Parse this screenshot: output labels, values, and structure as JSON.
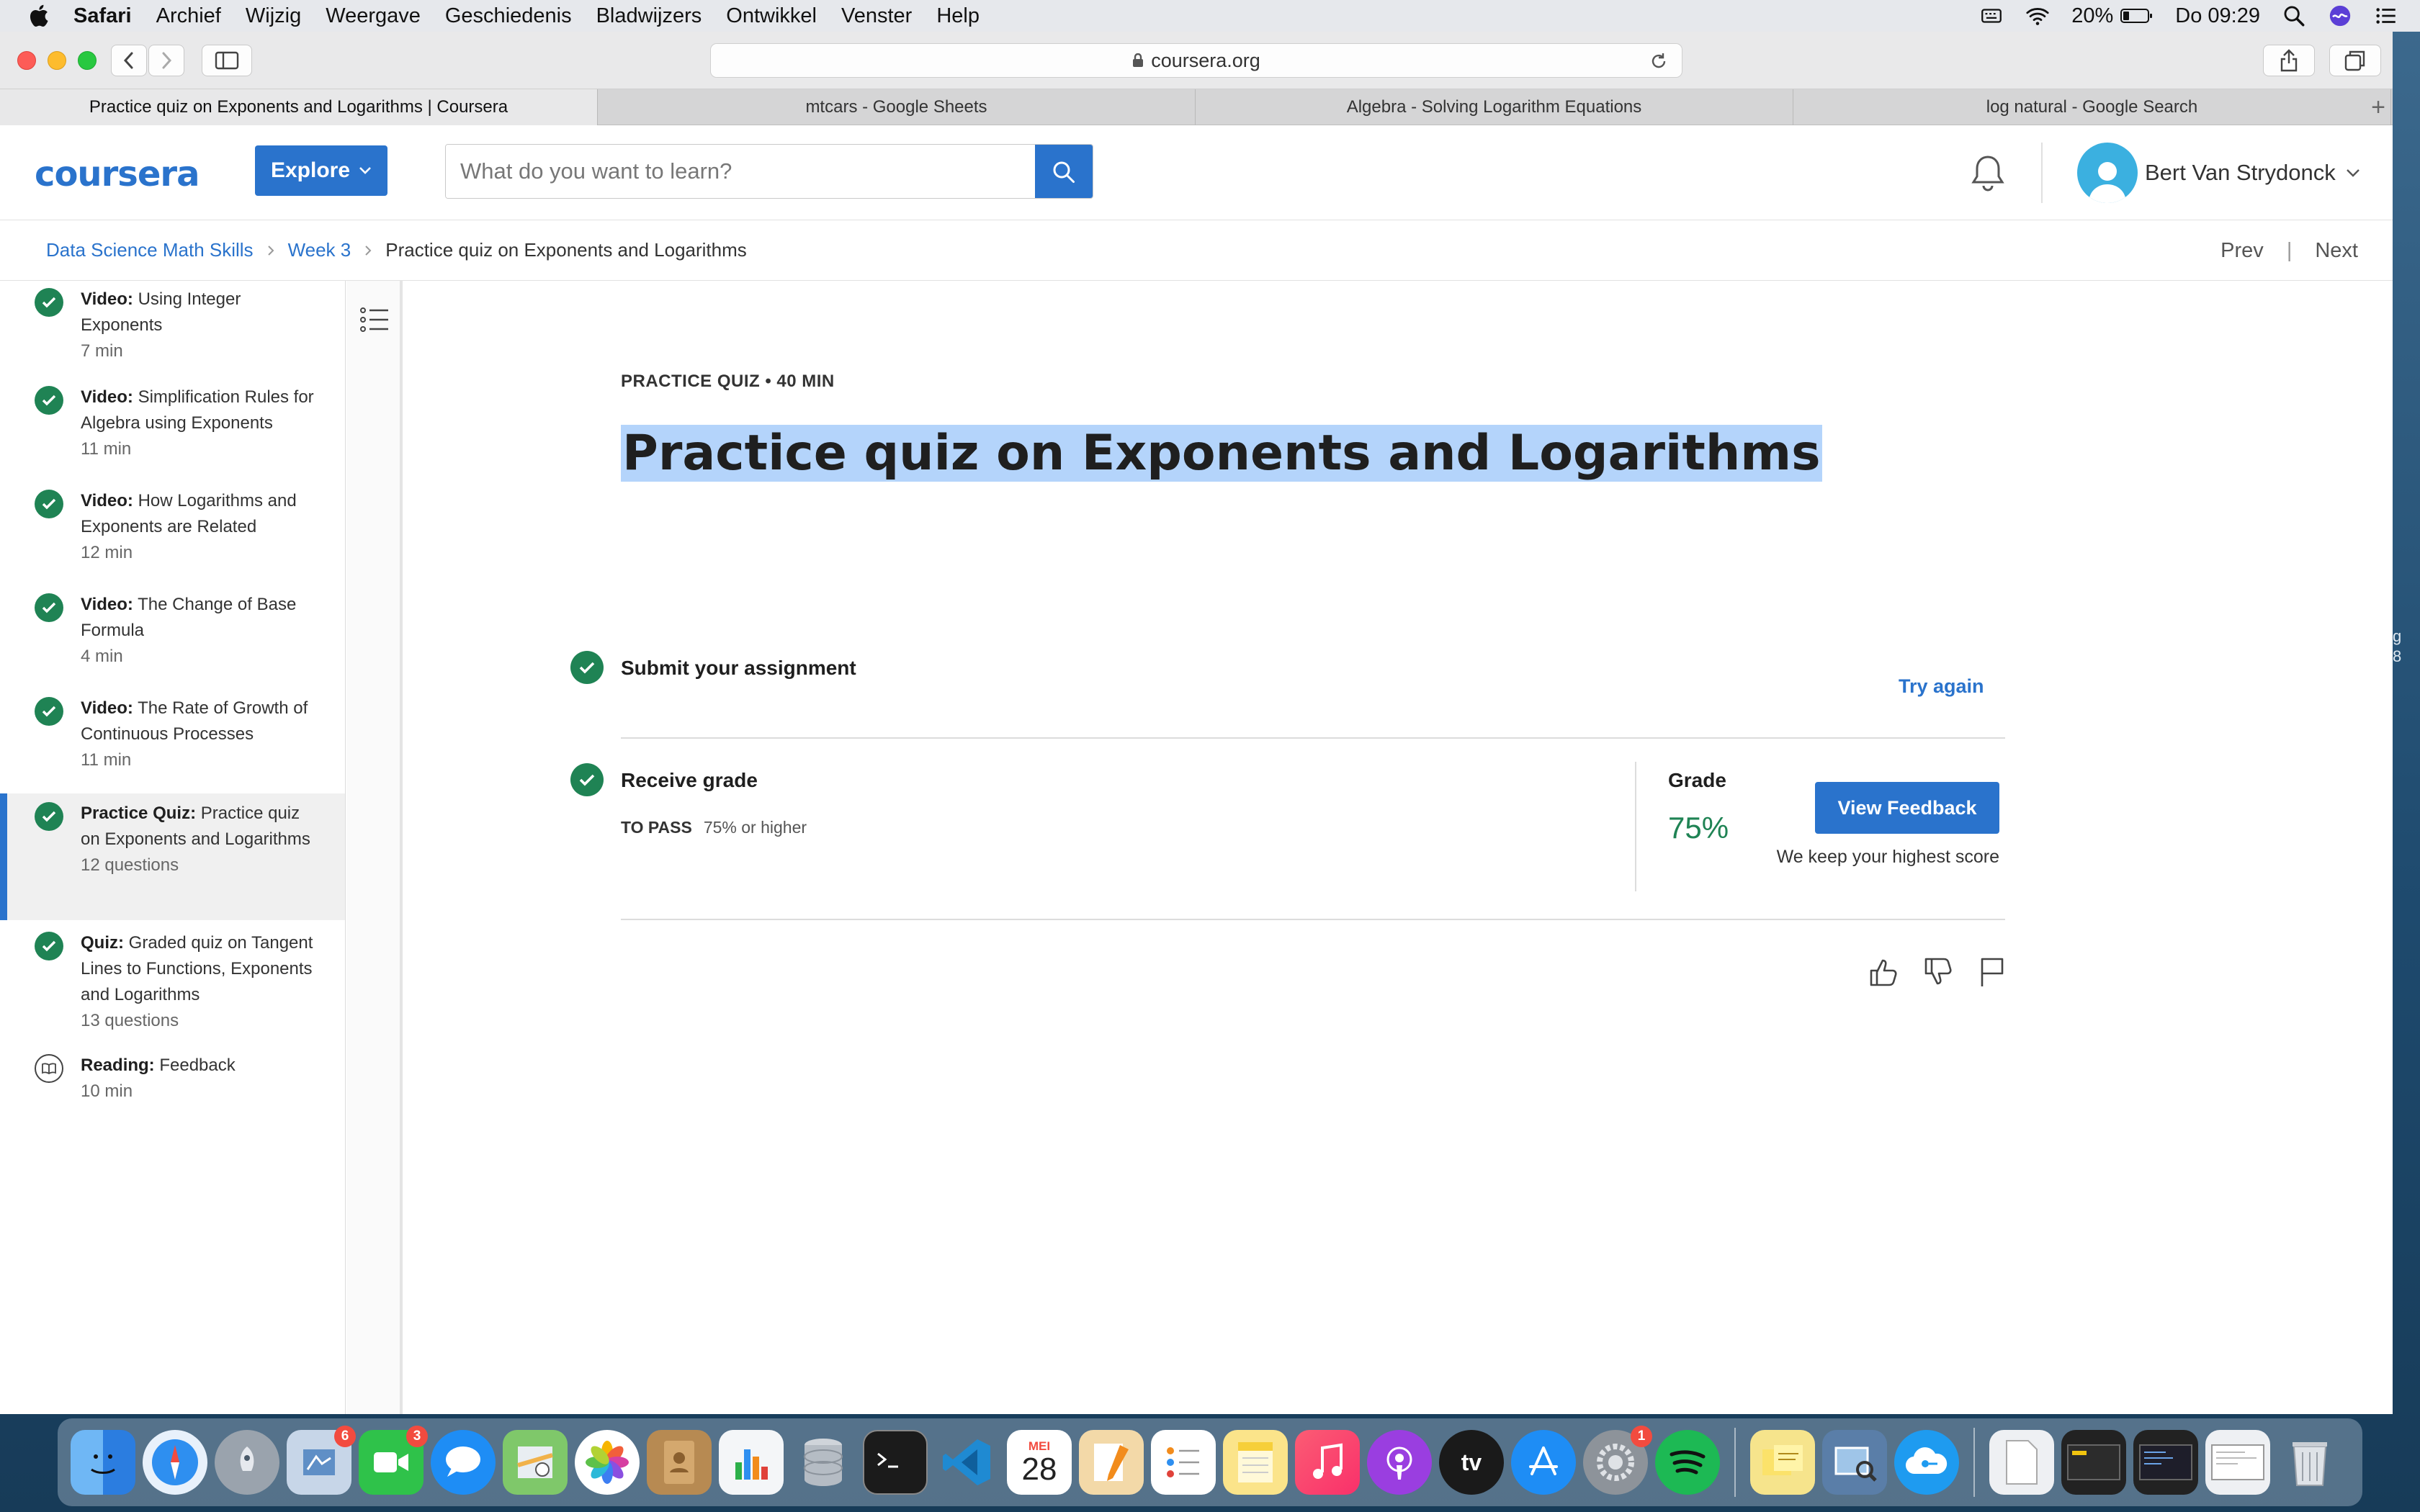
{
  "menubar": {
    "app": "Safari",
    "items": [
      "Archief",
      "Wijzig",
      "Weergave",
      "Geschiedenis",
      "Bladwijzers",
      "Ontwikkel",
      "Venster",
      "Help"
    ],
    "battery": "20%",
    "clock": "Do 09:29"
  },
  "browser": {
    "url": "coursera.org",
    "tabs": [
      "Practice quiz on Exponents and Logarithms | Coursera",
      "mtcars - Google Sheets",
      "Algebra - Solving Logarithm Equations",
      "log natural - Google Search"
    ],
    "tab_add": "+"
  },
  "header": {
    "logo": "coursera",
    "explore": "Explore",
    "search_placeholder": "What do you want to learn?",
    "user_name": "Bert Van Strydonck"
  },
  "breadcrumb": {
    "course": "Data Science Math Skills",
    "week": "Week 3",
    "current": "Practice quiz on Exponents and Logarithms",
    "prev": "Prev",
    "next": "Next",
    "divider": "|"
  },
  "sidebar": {
    "items": [
      {
        "type": "Video:",
        "title": "Using Integer Exponents",
        "meta": "7 min",
        "done": true
      },
      {
        "type": "Video:",
        "title": "Simplification Rules for Algebra using Exponents",
        "meta": "11 min",
        "done": true
      },
      {
        "type": "Video:",
        "title": "How Logarithms and Exponents are Related",
        "meta": "12 min",
        "done": true
      },
      {
        "type": "Video:",
        "title": "The Change of Base Formula",
        "meta": "4 min",
        "done": true
      },
      {
        "type": "Video:",
        "title": "The Rate of Growth of Continuous Processes",
        "meta": "11 min",
        "done": true
      },
      {
        "type": "Practice Quiz:",
        "title": "Practice quiz on Exponents and Logarithms",
        "meta": "12 questions",
        "done": true
      },
      {
        "type": "Quiz:",
        "title": "Graded quiz on Tangent Lines to Functions, Exponents and Logarithms",
        "meta": "13 questions",
        "done": true
      },
      {
        "type": "Reading:",
        "title": "Feedback",
        "meta": "10 min",
        "done": false
      }
    ]
  },
  "main": {
    "kicker": "PRACTICE QUIZ • 40 MIN",
    "title": "Practice quiz on Exponents and Logarithms",
    "submit_label": "Submit your assignment",
    "try_again": "Try again",
    "receive_label": "Receive grade",
    "to_pass_label": "TO PASS",
    "to_pass_value": "75% or higher",
    "grade_label": "Grade",
    "grade_value": "75%",
    "view_feedback": "View Feedback",
    "keep_note": "We keep your highest score"
  },
  "desktop_peek": [
    "g",
    "8"
  ],
  "dock": {
    "badges": {
      "mail": "6",
      "facetime": "3",
      "system_prefs": "1"
    },
    "calendar_month": "MEI",
    "calendar_day": "28",
    "tv_label": "tv"
  },
  "colors": {
    "accent": "#2a73cc",
    "success": "#1f8354",
    "highlight": "#b4d4fb"
  }
}
